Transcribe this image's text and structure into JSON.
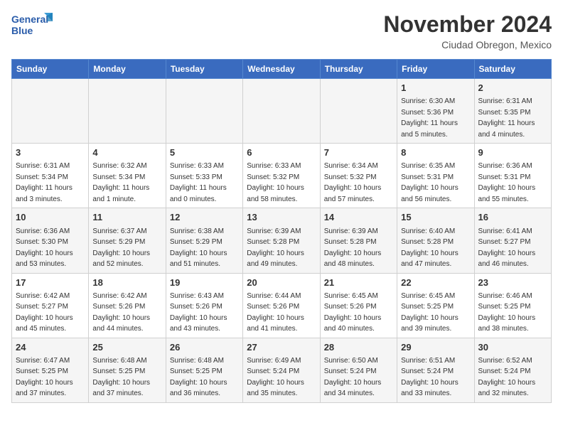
{
  "header": {
    "logo_line1": "General",
    "logo_line2": "Blue",
    "month": "November 2024",
    "location": "Ciudad Obregon, Mexico"
  },
  "weekdays": [
    "Sunday",
    "Monday",
    "Tuesday",
    "Wednesday",
    "Thursday",
    "Friday",
    "Saturday"
  ],
  "weeks": [
    [
      {
        "day": "",
        "detail": ""
      },
      {
        "day": "",
        "detail": ""
      },
      {
        "day": "",
        "detail": ""
      },
      {
        "day": "",
        "detail": ""
      },
      {
        "day": "",
        "detail": ""
      },
      {
        "day": "1",
        "detail": "Sunrise: 6:30 AM\nSunset: 5:36 PM\nDaylight: 11 hours\nand 5 minutes."
      },
      {
        "day": "2",
        "detail": "Sunrise: 6:31 AM\nSunset: 5:35 PM\nDaylight: 11 hours\nand 4 minutes."
      }
    ],
    [
      {
        "day": "3",
        "detail": "Sunrise: 6:31 AM\nSunset: 5:34 PM\nDaylight: 11 hours\nand 3 minutes."
      },
      {
        "day": "4",
        "detail": "Sunrise: 6:32 AM\nSunset: 5:34 PM\nDaylight: 11 hours\nand 1 minute."
      },
      {
        "day": "5",
        "detail": "Sunrise: 6:33 AM\nSunset: 5:33 PM\nDaylight: 11 hours\nand 0 minutes."
      },
      {
        "day": "6",
        "detail": "Sunrise: 6:33 AM\nSunset: 5:32 PM\nDaylight: 10 hours\nand 58 minutes."
      },
      {
        "day": "7",
        "detail": "Sunrise: 6:34 AM\nSunset: 5:32 PM\nDaylight: 10 hours\nand 57 minutes."
      },
      {
        "day": "8",
        "detail": "Sunrise: 6:35 AM\nSunset: 5:31 PM\nDaylight: 10 hours\nand 56 minutes."
      },
      {
        "day": "9",
        "detail": "Sunrise: 6:36 AM\nSunset: 5:31 PM\nDaylight: 10 hours\nand 55 minutes."
      }
    ],
    [
      {
        "day": "10",
        "detail": "Sunrise: 6:36 AM\nSunset: 5:30 PM\nDaylight: 10 hours\nand 53 minutes."
      },
      {
        "day": "11",
        "detail": "Sunrise: 6:37 AM\nSunset: 5:29 PM\nDaylight: 10 hours\nand 52 minutes."
      },
      {
        "day": "12",
        "detail": "Sunrise: 6:38 AM\nSunset: 5:29 PM\nDaylight: 10 hours\nand 51 minutes."
      },
      {
        "day": "13",
        "detail": "Sunrise: 6:39 AM\nSunset: 5:28 PM\nDaylight: 10 hours\nand 49 minutes."
      },
      {
        "day": "14",
        "detail": "Sunrise: 6:39 AM\nSunset: 5:28 PM\nDaylight: 10 hours\nand 48 minutes."
      },
      {
        "day": "15",
        "detail": "Sunrise: 6:40 AM\nSunset: 5:28 PM\nDaylight: 10 hours\nand 47 minutes."
      },
      {
        "day": "16",
        "detail": "Sunrise: 6:41 AM\nSunset: 5:27 PM\nDaylight: 10 hours\nand 46 minutes."
      }
    ],
    [
      {
        "day": "17",
        "detail": "Sunrise: 6:42 AM\nSunset: 5:27 PM\nDaylight: 10 hours\nand 45 minutes."
      },
      {
        "day": "18",
        "detail": "Sunrise: 6:42 AM\nSunset: 5:26 PM\nDaylight: 10 hours\nand 44 minutes."
      },
      {
        "day": "19",
        "detail": "Sunrise: 6:43 AM\nSunset: 5:26 PM\nDaylight: 10 hours\nand 43 minutes."
      },
      {
        "day": "20",
        "detail": "Sunrise: 6:44 AM\nSunset: 5:26 PM\nDaylight: 10 hours\nand 41 minutes."
      },
      {
        "day": "21",
        "detail": "Sunrise: 6:45 AM\nSunset: 5:26 PM\nDaylight: 10 hours\nand 40 minutes."
      },
      {
        "day": "22",
        "detail": "Sunrise: 6:45 AM\nSunset: 5:25 PM\nDaylight: 10 hours\nand 39 minutes."
      },
      {
        "day": "23",
        "detail": "Sunrise: 6:46 AM\nSunset: 5:25 PM\nDaylight: 10 hours\nand 38 minutes."
      }
    ],
    [
      {
        "day": "24",
        "detail": "Sunrise: 6:47 AM\nSunset: 5:25 PM\nDaylight: 10 hours\nand 37 minutes."
      },
      {
        "day": "25",
        "detail": "Sunrise: 6:48 AM\nSunset: 5:25 PM\nDaylight: 10 hours\nand 37 minutes."
      },
      {
        "day": "26",
        "detail": "Sunrise: 6:48 AM\nSunset: 5:25 PM\nDaylight: 10 hours\nand 36 minutes."
      },
      {
        "day": "27",
        "detail": "Sunrise: 6:49 AM\nSunset: 5:24 PM\nDaylight: 10 hours\nand 35 minutes."
      },
      {
        "day": "28",
        "detail": "Sunrise: 6:50 AM\nSunset: 5:24 PM\nDaylight: 10 hours\nand 34 minutes."
      },
      {
        "day": "29",
        "detail": "Sunrise: 6:51 AM\nSunset: 5:24 PM\nDaylight: 10 hours\nand 33 minutes."
      },
      {
        "day": "30",
        "detail": "Sunrise: 6:52 AM\nSunset: 5:24 PM\nDaylight: 10 hours\nand 32 minutes."
      }
    ]
  ]
}
